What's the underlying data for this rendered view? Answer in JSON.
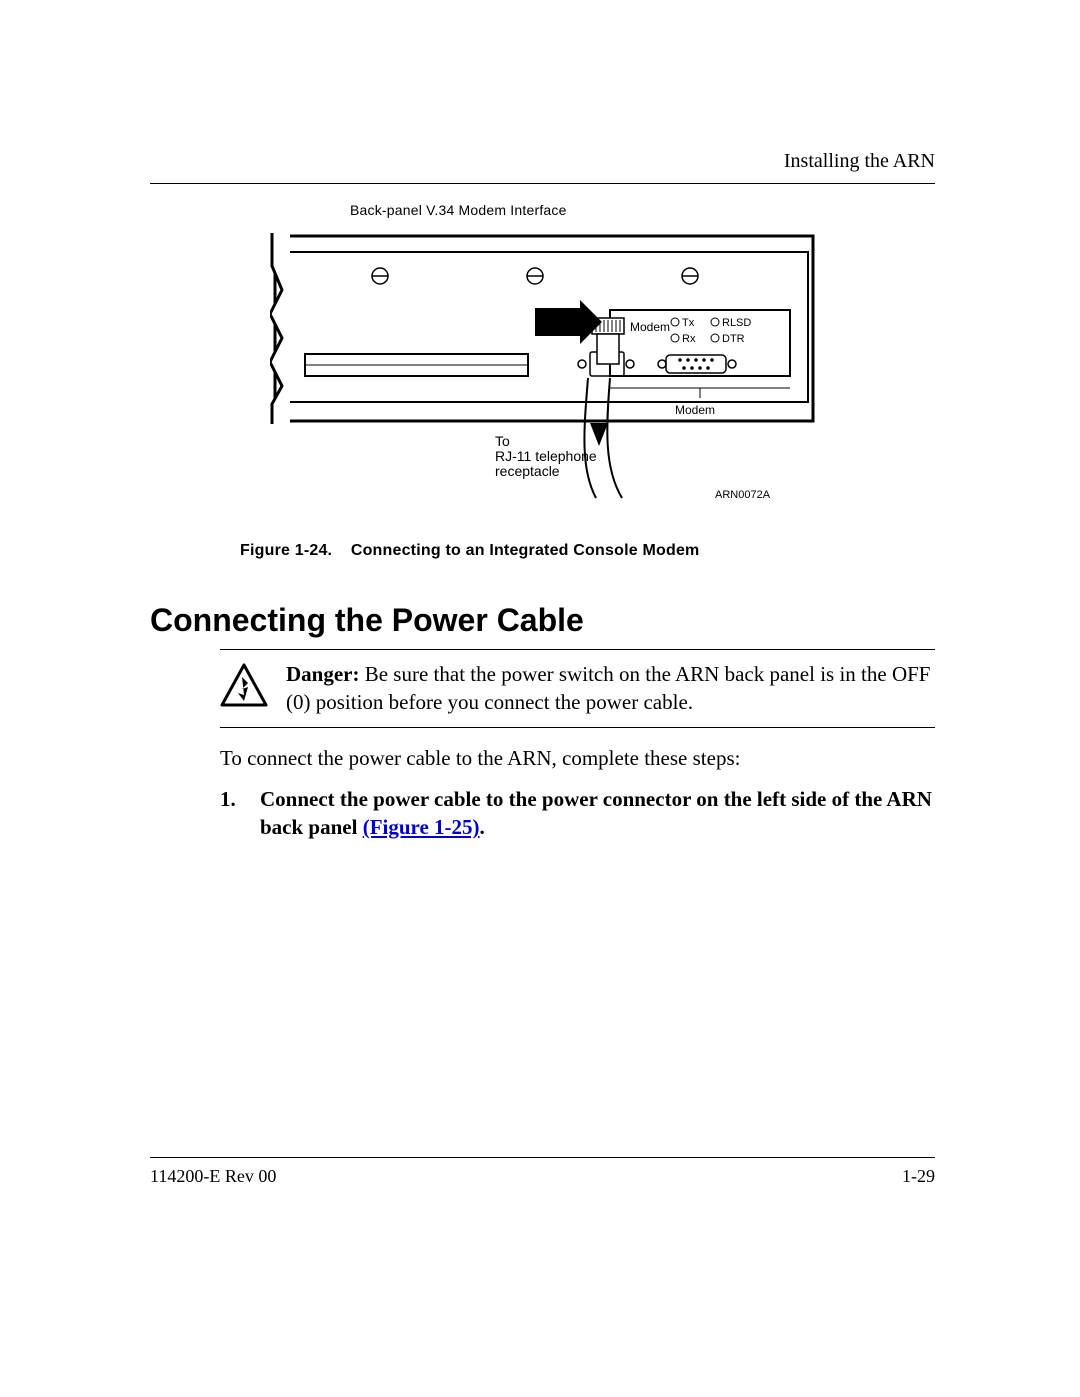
{
  "header": {
    "running_title": "Installing the ARN"
  },
  "figure": {
    "top_title": "Back-panel V.34 Modem Interface",
    "callout_to": "To",
    "callout_line2": "RJ-11 telephone",
    "callout_line3": "receptacle",
    "modem_label": "Modem",
    "bottom_modem_label": "Modem",
    "led_tx": "Tx",
    "led_rlsd": "RLSD",
    "led_rx": "Rx",
    "led_dtr": "DTR",
    "art_id": "ARN0072A",
    "caption_prefix": "Figure 1-24.",
    "caption_text": "Connecting to an Integrated Console Modem"
  },
  "section": {
    "title": "Connecting the Power Cable"
  },
  "danger": {
    "label": "Danger:",
    "text": " Be sure that the power switch on the ARN back panel is in the OFF (0) position before you connect the power cable."
  },
  "intro": "To connect the power cable to the ARN, complete these steps:",
  "steps": [
    {
      "num": "1.",
      "text_before": "Connect the power cable to the power connector on the left side of the ARN back panel ",
      "xref": "(Figure 1-25)",
      "text_after": "."
    }
  ],
  "footer": {
    "left": "114200-E Rev 00",
    "right": "1-29"
  }
}
